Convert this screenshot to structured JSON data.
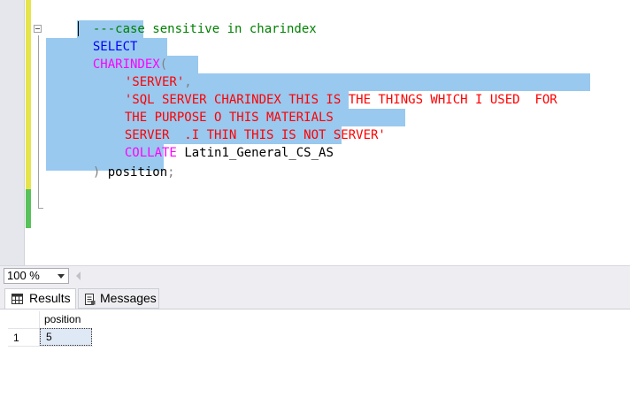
{
  "editor": {
    "lines": [
      {
        "id": "comment",
        "tokens": [
          "---case sensitive in charindex"
        ]
      },
      {
        "id": "select",
        "tokens": [
          "SELECT"
        ]
      },
      {
        "id": "charindex",
        "tokens": [
          "CHARINDEX",
          "("
        ]
      },
      {
        "id": "arg1",
        "tokens": [
          "'SERVER'",
          ","
        ]
      },
      {
        "id": "arg2a",
        "tokens": [
          "'SQL SERVER CHARINDEX THIS IS THE THINGS WHICH I USED  FOR"
        ]
      },
      {
        "id": "arg2b",
        "tokens": [
          "THE PURPOSE O THIS MATERIALS"
        ]
      },
      {
        "id": "arg2c",
        "tokens": [
          "SERVER  .I THIN THIS IS NOT SERVER'"
        ]
      },
      {
        "id": "collate",
        "tokens": [
          "COLLATE",
          "Latin1_General_CS_AS"
        ]
      },
      {
        "id": "close",
        "tokens": [
          ")",
          "position",
          ";"
        ]
      }
    ],
    "colors": {
      "keyword": "#0000ff",
      "function": "#ff00ff",
      "string": "#ff0000",
      "comment": "#008000",
      "selection": "#99c9ef"
    }
  },
  "zoom": {
    "value": "100 %"
  },
  "tabs": {
    "results": "Results",
    "messages": "Messages"
  },
  "results_grid": {
    "columns": [
      "position"
    ],
    "rows": [
      {
        "num": "1",
        "cells": [
          "5"
        ]
      }
    ]
  }
}
